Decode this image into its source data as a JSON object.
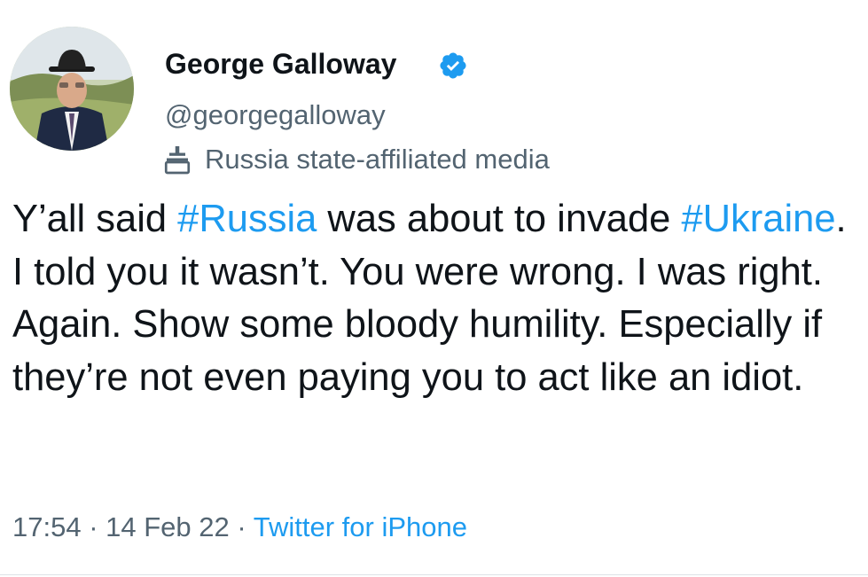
{
  "author": {
    "display_name": "George Galloway",
    "handle": "@georgegalloway",
    "label": "Russia state-affiliated media",
    "verified": true
  },
  "tweet": {
    "segments": [
      {
        "text": "Y’all said ",
        "type": "text"
      },
      {
        "text": "#Russia",
        "type": "hashtag"
      },
      {
        "text": " was about to invade ",
        "type": "text"
      },
      {
        "text": "#Ukraine",
        "type": "hashtag"
      },
      {
        "text": ". I told you it wasn’t. You were wrong. I was right. Again. Show some bloody humility. Especially if they’re not even paying you to act like an idiot.",
        "type": "text"
      }
    ]
  },
  "meta": {
    "time": "17:54",
    "separator": " · ",
    "date": "14 Feb 22",
    "source": "Twitter for iPhone"
  },
  "colors": {
    "link": "#1d9bf0",
    "secondary_text": "#536471",
    "primary_text": "#0f1419"
  },
  "icons": {
    "verified": "verified-badge-icon",
    "label": "podium-icon"
  }
}
